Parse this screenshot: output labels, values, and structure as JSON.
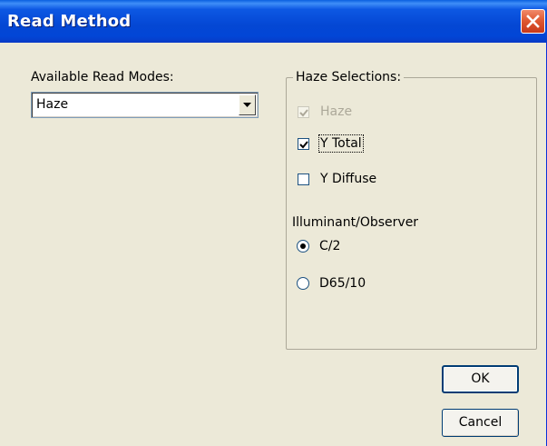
{
  "window": {
    "title": "Read Method"
  },
  "read_modes": {
    "label": "Available Read Modes:",
    "selected": "Haze"
  },
  "haze_selections": {
    "title": "Haze Selections:",
    "checkboxes": [
      {
        "label": "Haze",
        "checked": true,
        "enabled": false
      },
      {
        "label": "Y Total",
        "checked": true,
        "enabled": true
      },
      {
        "label": "Y Diffuse",
        "checked": false,
        "enabled": true
      }
    ],
    "illuminant_label": "Illuminant/Observer",
    "radios": [
      {
        "label": "C/2",
        "selected": true
      },
      {
        "label": "D65/10",
        "selected": false
      }
    ]
  },
  "buttons": {
    "ok": "OK",
    "cancel": "Cancel"
  }
}
